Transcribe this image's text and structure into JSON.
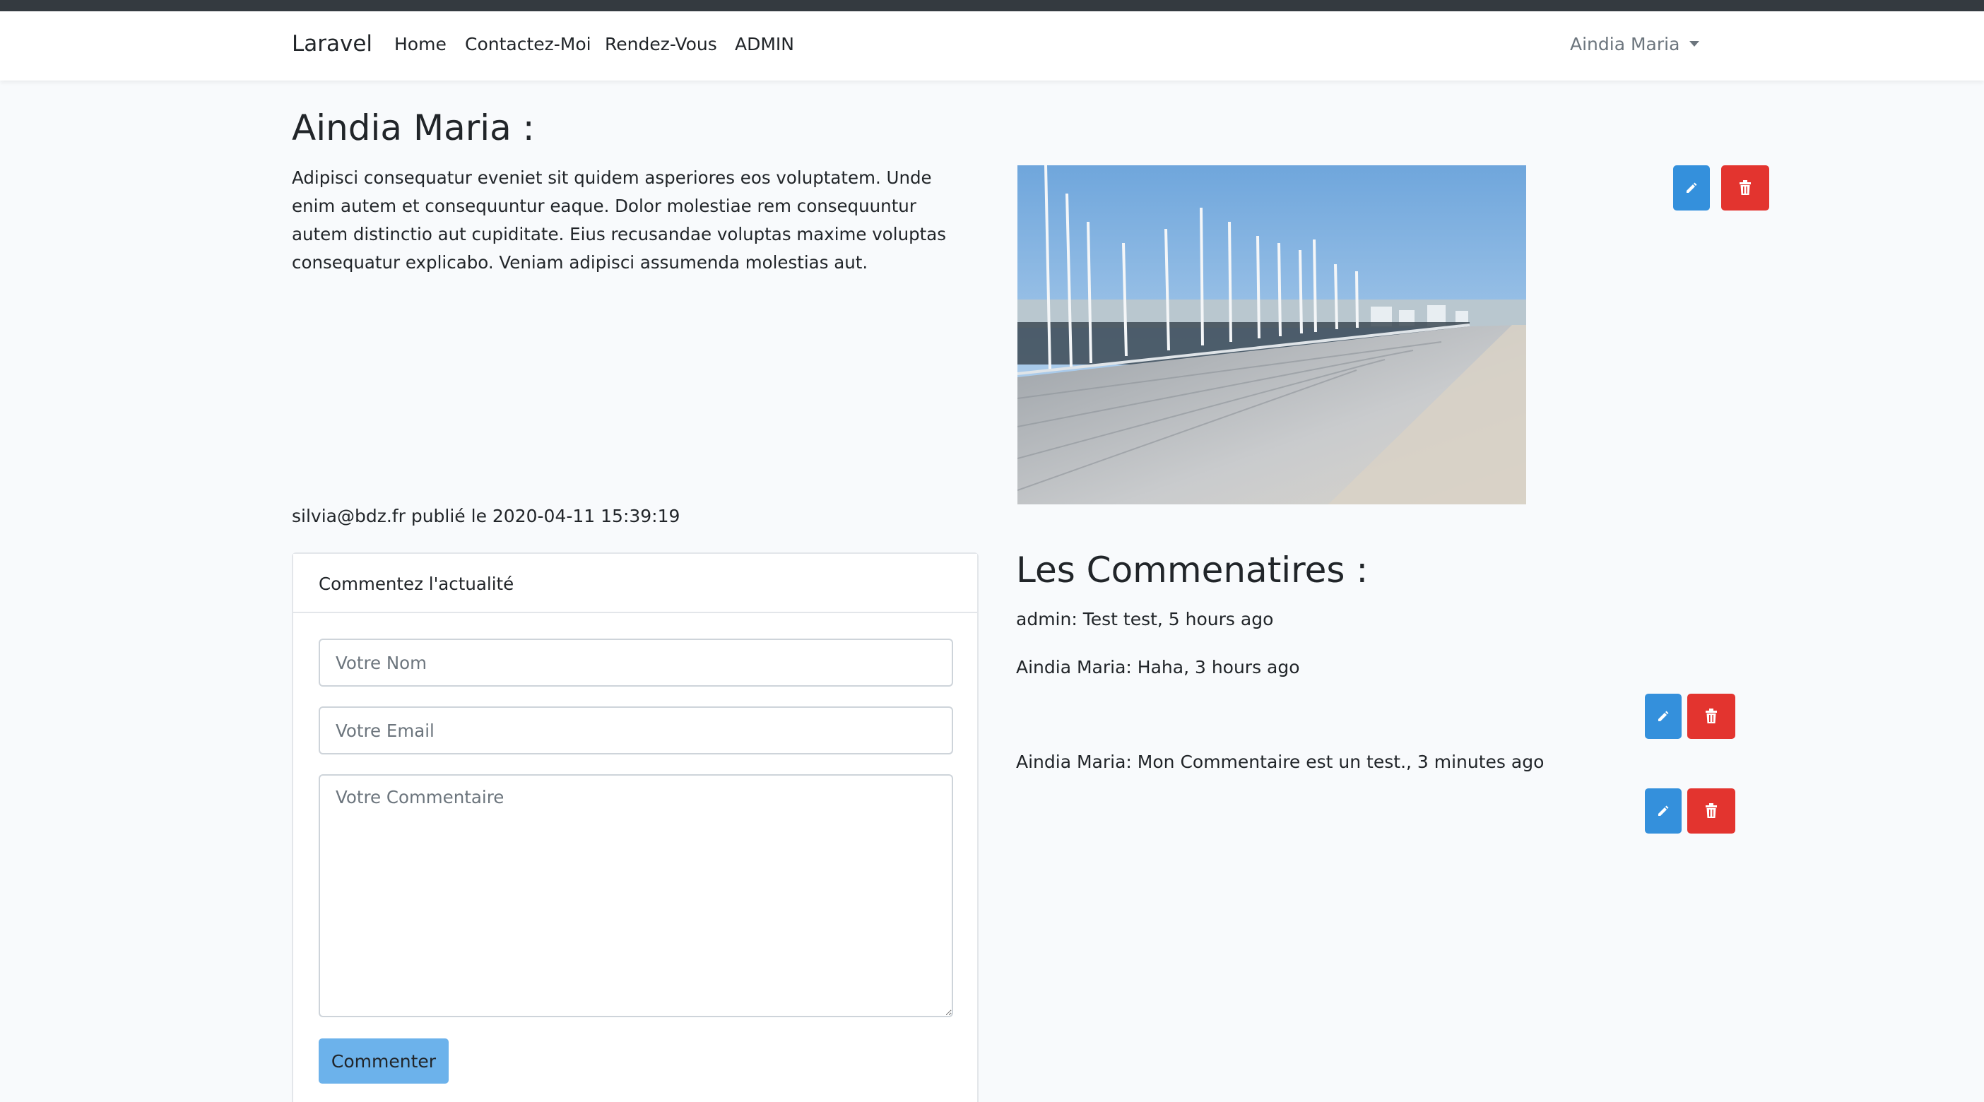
{
  "navbar": {
    "brand": "Laravel",
    "links": [
      "Home",
      "Contactez-Moi",
      "Rendez-Vous",
      "ADMIN"
    ],
    "user": "Aindia Maria"
  },
  "post": {
    "title": "Aindia Maria :",
    "body": "Adipisci consequatur eveniet sit quidem asperiores eos voluptatem. Unde enim autem et consequuntur eaque. Dolor molestiae rem consequuntur autem distinctio aut cupiditate. Eius recusandae voluptas maxime voluptas consequatur explicabo. Veniam adipisci assumenda molestias aut.",
    "author_email": "silvia@bdz.fr",
    "published_text": " publié le 2020-04-11 15:39:19",
    "image_icon": "marina-photo"
  },
  "comment_form": {
    "header": "Commentez l'actualité",
    "name_placeholder": "Votre Nom",
    "email_placeholder": "Votre Email",
    "comment_placeholder": "Votre Commentaire",
    "submit_label": "Commenter"
  },
  "comments_section": {
    "title": "Les Commenatires :",
    "items": [
      {
        "author": "admin",
        "separator": ": ",
        "text": "Test test, 5 hours ago"
      },
      {
        "author": "Aindia Maria",
        "separator": ": ",
        "text": "Haha, 3 hours ago"
      },
      {
        "author": "Aindia Maria",
        "separator": ": ",
        "text": "Mon Commentaire est un test., 3 minutes ago"
      }
    ]
  },
  "icons": {
    "edit": "pencil-icon",
    "delete": "trash-icon"
  },
  "colors": {
    "primary": "#3490dc",
    "danger": "#e3342f",
    "info_light": "#6cb2eb",
    "navbar_dark": "#343a40"
  }
}
